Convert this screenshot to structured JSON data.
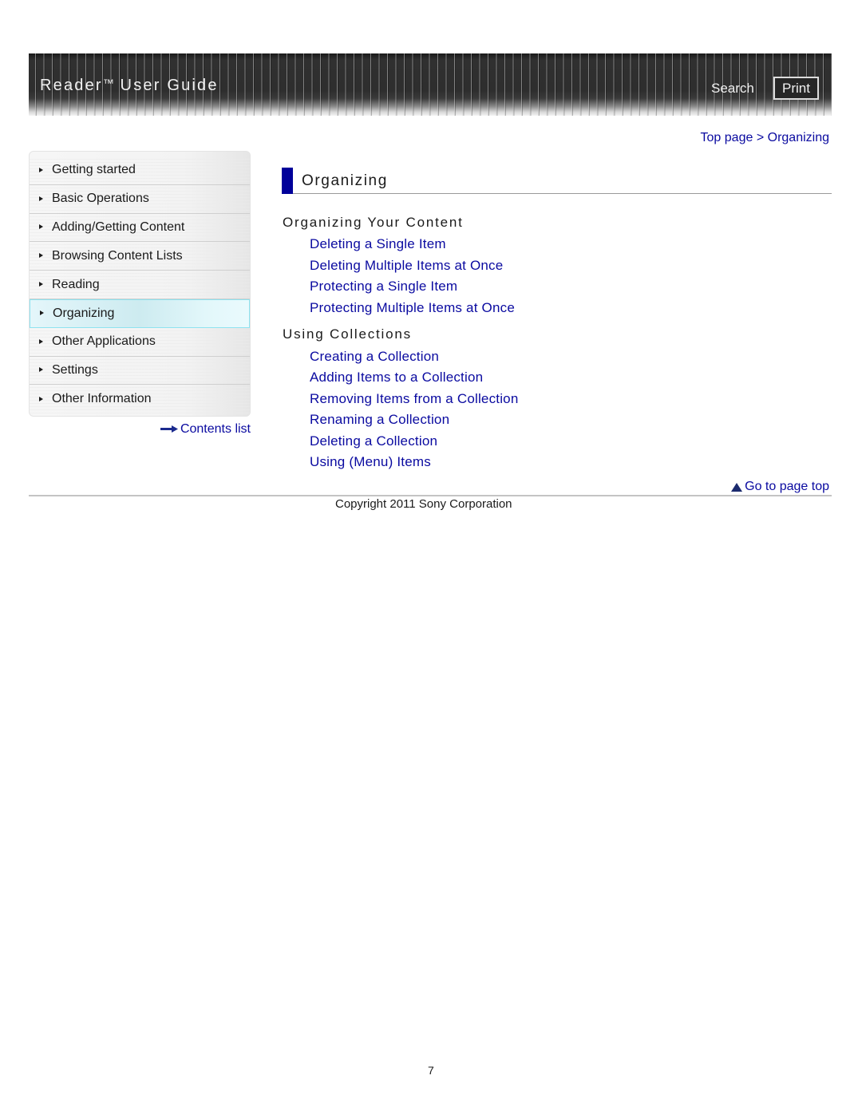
{
  "header": {
    "title": "Reader",
    "trademark": "™",
    "title_rest": " User Guide",
    "search_label": "Search",
    "print_label": "Print"
  },
  "breadcrumb": {
    "items": [
      {
        "label": "Top page"
      },
      {
        "label": "Organizing"
      }
    ],
    "separator": ">"
  },
  "sidebar": {
    "items": [
      {
        "label": "Getting started",
        "active": false
      },
      {
        "label": "Basic Operations",
        "active": false
      },
      {
        "label": "Adding/Getting Content",
        "active": false
      },
      {
        "label": "Browsing Content Lists",
        "active": false
      },
      {
        "label": "Reading",
        "active": false
      },
      {
        "label": "Organizing",
        "active": true
      },
      {
        "label": "Other Applications",
        "active": false
      },
      {
        "label": "Settings",
        "active": false
      },
      {
        "label": "Other Information",
        "active": false
      }
    ],
    "contents_list_label": "Contents list",
    "contents_icon": "arrow-right-icon"
  },
  "main": {
    "title": "Organizing",
    "accent_color": "#00009a",
    "link_color": "#0a0aa0",
    "sections": [
      {
        "heading": "Organizing Your Content",
        "links": [
          "Deleting a Single Item",
          "Deleting Multiple Items at Once",
          "Protecting a Single Item",
          "Protecting Multiple Items at Once"
        ]
      },
      {
        "heading": "Using Collections",
        "links": [
          "Creating a Collection",
          "Adding Items to a Collection",
          "Removing Items from a Collection",
          "Renaming a Collection",
          "Deleting a Collection",
          "Using (Menu) Items"
        ]
      }
    ]
  },
  "footer": {
    "page_top_label": "Go to page top",
    "page_top_icon": "up-triangle-icon",
    "copyright": "Copyright 2011 Sony Corporation",
    "page_number": "7"
  }
}
